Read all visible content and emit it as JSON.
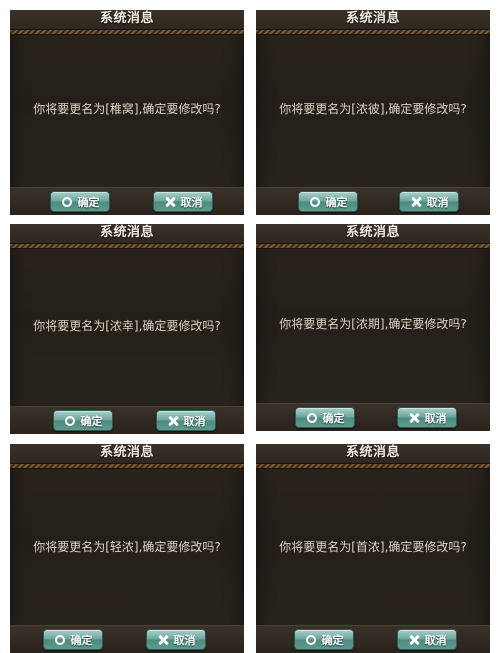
{
  "dialogs": [
    {
      "title": "系统消息",
      "message": "你将要更名为[稚窝],确定要修改吗?",
      "confirm_label": "确定",
      "cancel_label": "取消"
    },
    {
      "title": "系统消息",
      "message": "你将要更名为[浓彼],确定要修改吗?",
      "confirm_label": "确定",
      "cancel_label": "取消"
    },
    {
      "title": "系统消息",
      "message": "你将要更名为[浓幸],确定要修改吗?",
      "confirm_label": "确定",
      "cancel_label": "取消"
    },
    {
      "title": "系统消息",
      "message": "你将要更名为[浓期],确定要修改吗?",
      "confirm_label": "确定",
      "cancel_label": "取消"
    },
    {
      "title": "系统消息",
      "message": "你将要更名为[轻浓],确定要修改吗?",
      "confirm_label": "确定",
      "cancel_label": "取消"
    },
    {
      "title": "系统消息",
      "message": "你将要更名为[首浓],确定要修改吗?",
      "confirm_label": "确定",
      "cancel_label": "取消"
    }
  ],
  "icons": {
    "confirm": "circle-icon",
    "cancel": "close-icon"
  },
  "colors": {
    "dialog_bg": "#252019",
    "button_teal": "#6aa59b",
    "text_light": "#ddd3c3",
    "title_text": "#f3ece2"
  }
}
